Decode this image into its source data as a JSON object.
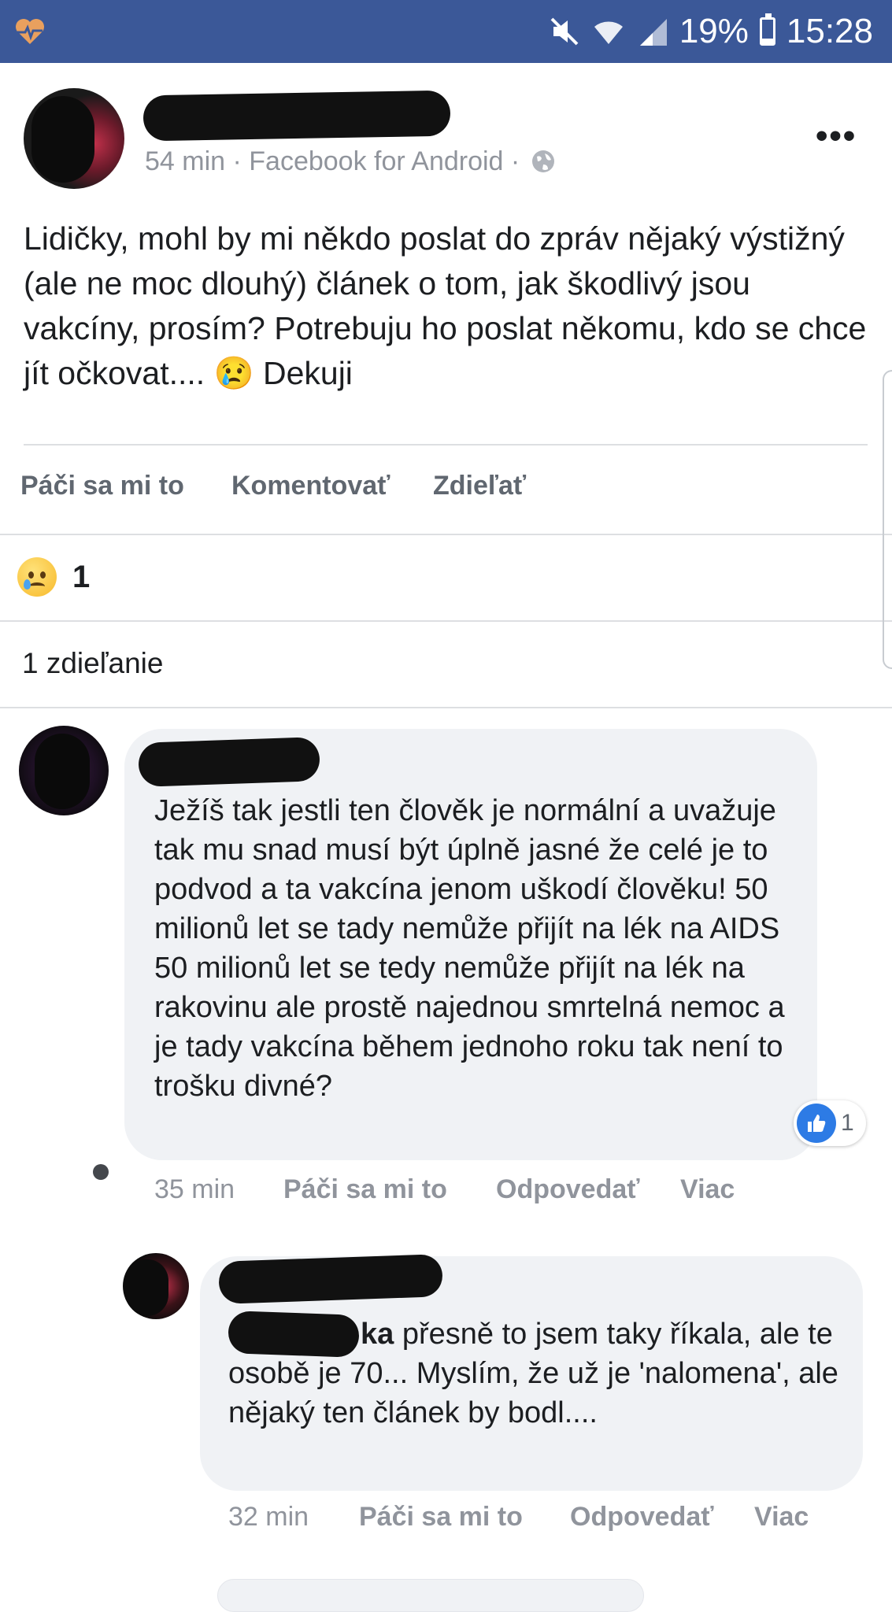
{
  "status_bar": {
    "battery": "19%",
    "battery_level": 0.19,
    "time": "15:28",
    "icons": [
      "heart-pulse-icon",
      "mute-icon",
      "wifi-icon",
      "signal-icon",
      "battery-icon"
    ]
  },
  "post": {
    "meta": "54 min · Facebook for Android ·",
    "privacy_icon": "globe-icon",
    "text": "Lidičky, mohl by mi někdo poslat do zpráv nějaký výstižný (ale ne moc dlouhý) článek o tom, jak škodlivý jsou vakcíny, prosím? Potrebuju ho poslat někomu, kdo se chce jít očkovat.... 😢 Dekuji",
    "actions": {
      "like": "Páči sa mi to",
      "comment": "Komentovať",
      "share": "Zdieľať"
    },
    "reaction_count": "1",
    "shares": "1 zdieľanie"
  },
  "comments": [
    {
      "text": "Ježíš tak jestli ten člověk je normální a uvažuje tak mu snad musí být úplně jasné že celé je to podvod a ta vakcína jenom uškodí člověku! 50 milionů let se tady nemůže přijít na lék na AIDS 50 milionů let se tedy nemůže přijít na lék na rakovinu ale prostě najednou smrtelná nemoc a je tady vakcína během jednoho roku tak není to trošku divné?",
      "time": "35 min",
      "like": "Páči sa mi to",
      "reply": "Odpovedať",
      "more": "Viac",
      "like_count": "1"
    },
    {
      "mention_suffix": "ka",
      "text": " přesně to jsem taky říkala, ale te osobě je 70... Myslím, že už je 'nalomena', ale nějaký ten článek by bodl....",
      "time": "32 min",
      "like": "Páči sa mi to",
      "reply": "Odpovedať",
      "more": "Viac"
    }
  ],
  "colors": {
    "status_bar": "#3b5898",
    "bubble": "#f0f2f5",
    "meta_gray": "#90949c",
    "like_blue": "#2d7be5"
  }
}
